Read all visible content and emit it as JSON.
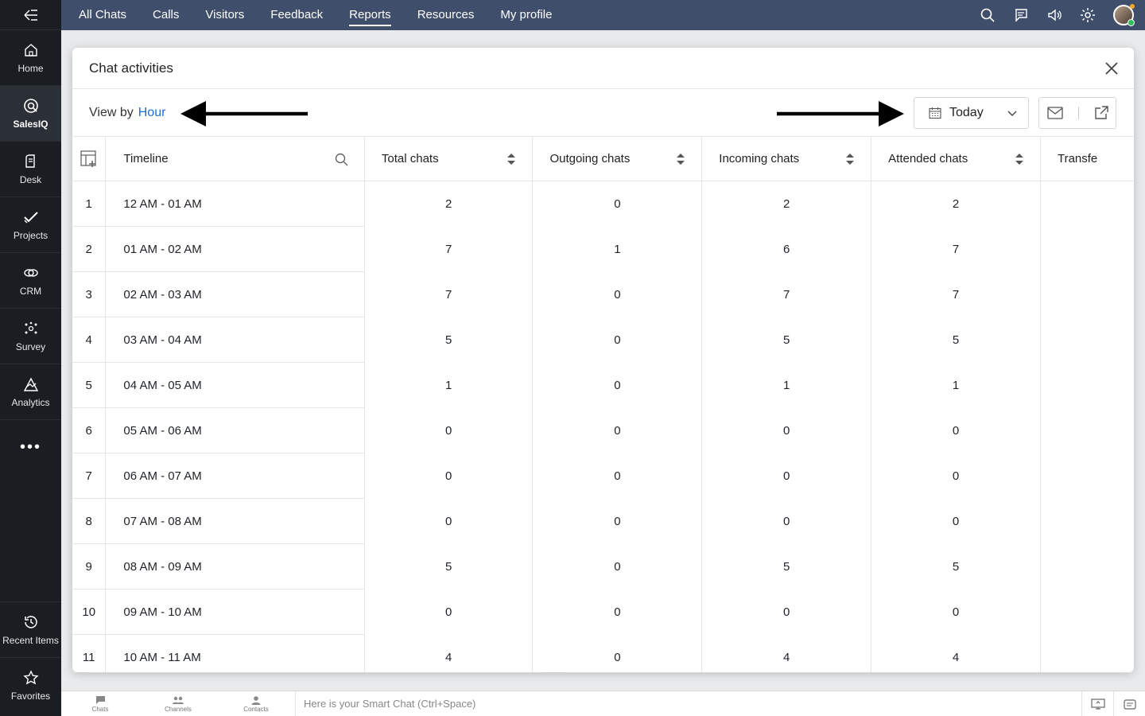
{
  "sidebar": {
    "items": [
      {
        "label": "Home",
        "icon": "home-icon"
      },
      {
        "label": "SalesIQ",
        "icon": "salesiq-icon",
        "active": true
      },
      {
        "label": "Desk",
        "icon": "desk-icon"
      },
      {
        "label": "Projects",
        "icon": "projects-icon"
      },
      {
        "label": "CRM",
        "icon": "crm-icon"
      },
      {
        "label": "Survey",
        "icon": "survey-icon"
      },
      {
        "label": "Analytics",
        "icon": "analytics-icon"
      }
    ],
    "more": "•••",
    "bottom": [
      {
        "label": "Recent Items",
        "icon": "history-icon"
      },
      {
        "label": "Favorites",
        "icon": "star-icon"
      }
    ]
  },
  "topnav": {
    "items": [
      "All Chats",
      "Calls",
      "Visitors",
      "Feedback",
      "Reports",
      "Resources",
      "My profile"
    ],
    "active": "Reports"
  },
  "bottombar": {
    "tabs": [
      "Chats",
      "Channels",
      "Contacts"
    ],
    "smart_chat_placeholder": "Here is your Smart Chat (Ctrl+Space)"
  },
  "modal": {
    "title": "Chat activities",
    "view_by_label": "View by",
    "view_by_value": "Hour",
    "date_range": "Today"
  },
  "table": {
    "columns": [
      "Timeline",
      "Total chats",
      "Outgoing chats",
      "Incoming chats",
      "Attended chats",
      "Transfe"
    ],
    "rows": [
      {
        "idx": "1",
        "time": "12 AM - 01 AM",
        "total": "2",
        "outgoing": "0",
        "incoming": "2",
        "attended": "2"
      },
      {
        "idx": "2",
        "time": "01 AM - 02 AM",
        "total": "7",
        "outgoing": "1",
        "incoming": "6",
        "attended": "7"
      },
      {
        "idx": "3",
        "time": "02 AM - 03 AM",
        "total": "7",
        "outgoing": "0",
        "incoming": "7",
        "attended": "7"
      },
      {
        "idx": "4",
        "time": "03 AM - 04 AM",
        "total": "5",
        "outgoing": "0",
        "incoming": "5",
        "attended": "5"
      },
      {
        "idx": "5",
        "time": "04 AM - 05 AM",
        "total": "1",
        "outgoing": "0",
        "incoming": "1",
        "attended": "1"
      },
      {
        "idx": "6",
        "time": "05 AM - 06 AM",
        "total": "0",
        "outgoing": "0",
        "incoming": "0",
        "attended": "0"
      },
      {
        "idx": "7",
        "time": "06 AM - 07 AM",
        "total": "0",
        "outgoing": "0",
        "incoming": "0",
        "attended": "0"
      },
      {
        "idx": "8",
        "time": "07 AM - 08 AM",
        "total": "0",
        "outgoing": "0",
        "incoming": "0",
        "attended": "0"
      },
      {
        "idx": "9",
        "time": "08 AM - 09 AM",
        "total": "5",
        "outgoing": "0",
        "incoming": "5",
        "attended": "5"
      },
      {
        "idx": "10",
        "time": "09 AM - 10 AM",
        "total": "0",
        "outgoing": "0",
        "incoming": "0",
        "attended": "0"
      },
      {
        "idx": "11",
        "time": "10 AM - 11 AM",
        "total": "4",
        "outgoing": "0",
        "incoming": "4",
        "attended": "4"
      }
    ]
  },
  "colors": {
    "topnav_bg": "#3f4f6b",
    "sidebar_bg": "#1a1d21",
    "link": "#1a6fd6"
  }
}
